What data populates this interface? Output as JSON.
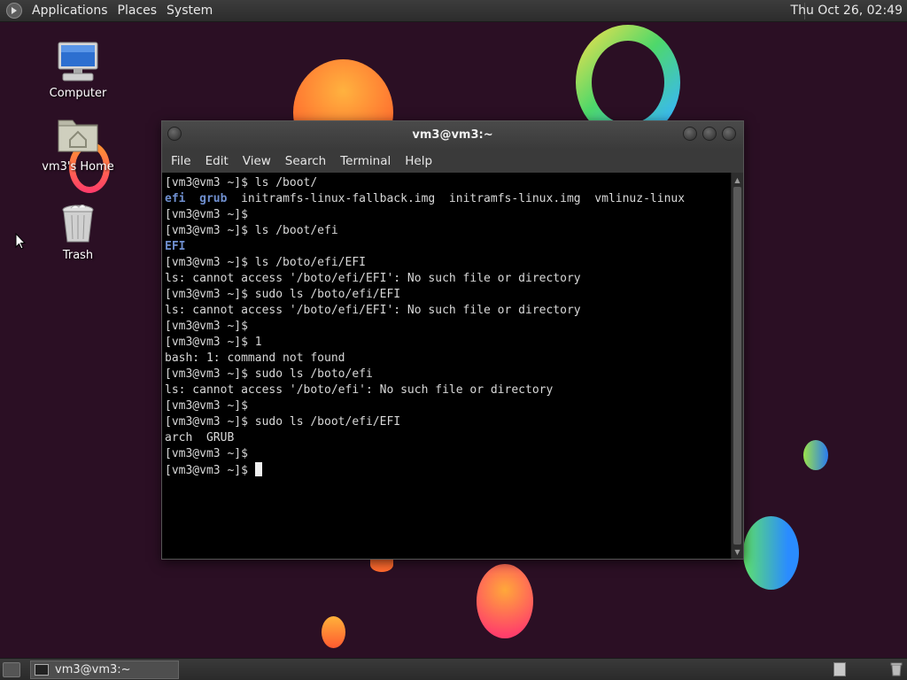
{
  "top_panel": {
    "menus": [
      "Applications",
      "Places",
      "System"
    ],
    "clock": "Thu Oct 26, 02:49"
  },
  "desktop": {
    "icons": [
      {
        "label": "Computer",
        "icon": "computer-icon"
      },
      {
        "label": "vm3's Home",
        "icon": "home-folder-icon"
      },
      {
        "label": "Trash",
        "icon": "trash-icon"
      }
    ]
  },
  "terminal": {
    "title": "vm3@vm3:~",
    "menus": [
      "File",
      "Edit",
      "View",
      "Search",
      "Terminal",
      "Help"
    ],
    "prompt": "[vm3@vm3 ~]$",
    "lines": [
      "[vm3@vm3 ~]$ ls /boot/",
      "efi  grub  initramfs-linux-fallback.img  initramfs-linux.img  vmlinuz-linux",
      "[vm3@vm3 ~]$",
      "[vm3@vm3 ~]$ ls /boot/efi",
      "EFI",
      "[vm3@vm3 ~]$ ls /boto/efi/EFI",
      "ls: cannot access '/boto/efi/EFI': No such file or directory",
      "[vm3@vm3 ~]$ sudo ls /boto/efi/EFI",
      "ls: cannot access '/boto/efi/EFI': No such file or directory",
      "[vm3@vm3 ~]$",
      "[vm3@vm3 ~]$ 1",
      "bash: 1: command not found",
      "[vm3@vm3 ~]$ sudo ls /boto/efi",
      "ls: cannot access '/boto/efi': No such file or directory",
      "[vm3@vm3 ~]$",
      "[vm3@vm3 ~]$ sudo ls /boot/efi/EFI",
      "arch  GRUB",
      "[vm3@vm3 ~]$",
      "[vm3@vm3 ~]$ "
    ],
    "dir_color": "#6f8fcf"
  },
  "bottom_panel": {
    "tasks": [
      {
        "label": "vm3@vm3:~",
        "icon": "terminal-icon"
      }
    ]
  }
}
